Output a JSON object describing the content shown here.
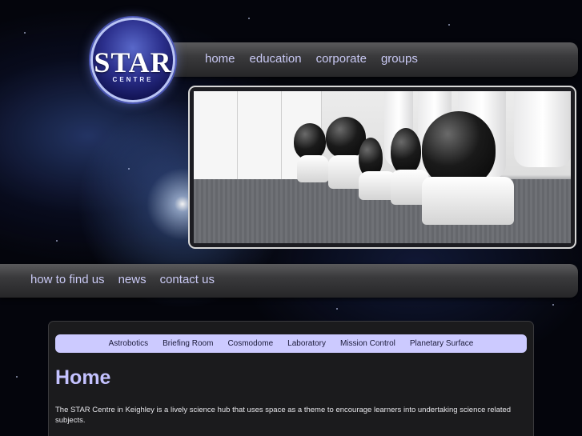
{
  "logo": {
    "word": "STAR",
    "sub": "CENTRE",
    "icon": "star-centre-logo"
  },
  "top_nav": [
    {
      "label": "home"
    },
    {
      "label": "education"
    },
    {
      "label": "corporate"
    },
    {
      "label": "groups"
    }
  ],
  "hero": {
    "subject": "astronaut helmets lined up on carpet"
  },
  "sub_nav": [
    {
      "label": "how to find us"
    },
    {
      "label": "news"
    },
    {
      "label": "contact us"
    }
  ],
  "room_nav": [
    {
      "label": "Astrobotics"
    },
    {
      "label": "Briefing Room"
    },
    {
      "label": "Cosmodome"
    },
    {
      "label": "Laboratory"
    },
    {
      "label": "Mission Control"
    },
    {
      "label": "Planetary Surface"
    }
  ],
  "main": {
    "title": "Home",
    "paragraph1": "The STAR Centre in Keighley is a lively science hub that uses space as a theme to encourage learners into undertaking science related subjects.",
    "paragraph2": ""
  },
  "colors": {
    "nav_text": "#c9c9f4",
    "pill_bg": "#cccaff",
    "title": "#c4c2ff",
    "bar_dark": "#262628"
  }
}
